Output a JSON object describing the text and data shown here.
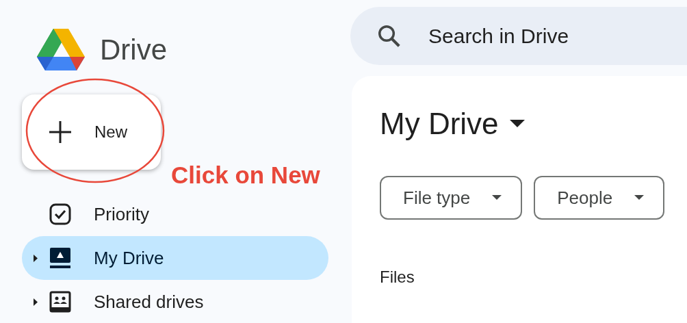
{
  "app": {
    "name": "Drive"
  },
  "new_button": {
    "label": "New"
  },
  "annotation": {
    "text": "Click on New"
  },
  "nav": [
    {
      "kind": "priority",
      "label": "Priority",
      "selected": false,
      "expandable": false
    },
    {
      "kind": "my-drive",
      "label": "My Drive",
      "selected": true,
      "expandable": true
    },
    {
      "kind": "shared-drives",
      "label": "Shared drives",
      "selected": false,
      "expandable": true
    }
  ],
  "search": {
    "placeholder": "Search in Drive"
  },
  "page": {
    "title": "My Drive"
  },
  "filters": [
    {
      "label": "File type"
    },
    {
      "label": "People"
    }
  ],
  "section": {
    "title": "Files"
  }
}
